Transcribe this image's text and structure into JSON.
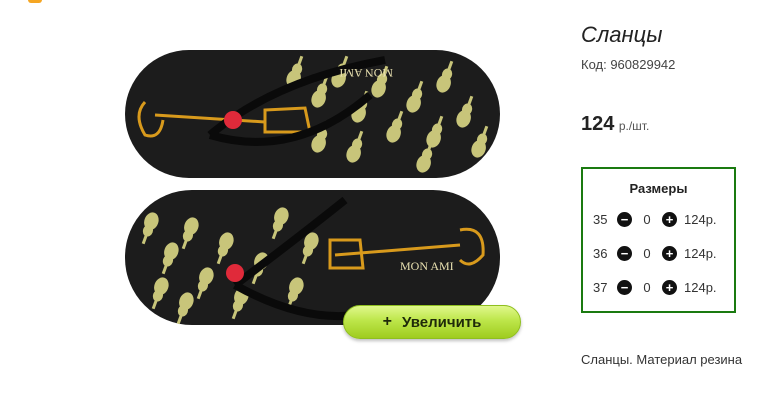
{
  "product": {
    "title": "Сланцы",
    "code": "Код: 960829942",
    "price": {
      "amount": "124",
      "unit": "р./шт."
    },
    "zoom_button": {
      "icon": "plus-icon",
      "label": "Увеличить"
    },
    "image_text": "MON AMI",
    "description": "Сланцы. Материал резина"
  },
  "sizes": {
    "title": "Размеры",
    "rows": [
      {
        "size": "35",
        "qty": "0",
        "price": "124р."
      },
      {
        "size": "36",
        "qty": "0",
        "price": "124р."
      },
      {
        "size": "37",
        "qty": "0",
        "price": "124р."
      }
    ]
  },
  "colors": {
    "sizes_border": "#1a7a10",
    "zoom_button": "#b5df3c",
    "top_accent": "#f5a623",
    "sole": "#1c1c1c",
    "print": "#c8c57a"
  }
}
